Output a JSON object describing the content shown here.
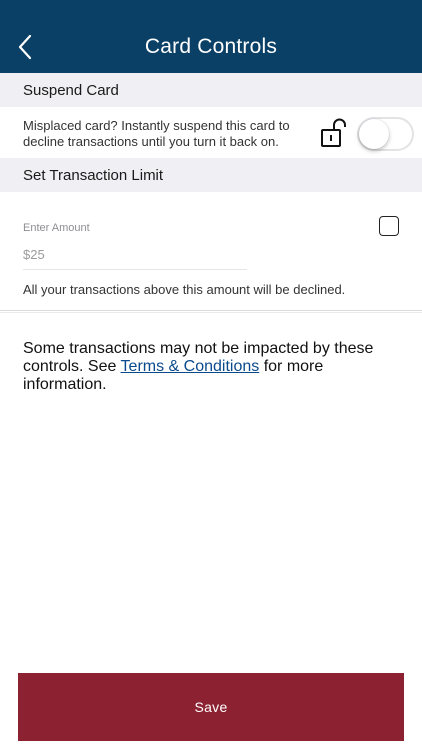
{
  "header": {
    "title": "Card Controls",
    "back_icon": "chevron-left-icon",
    "bg_color": "#0a4066"
  },
  "suspend": {
    "section_title": "Suspend Card",
    "description": "Misplaced card? Instantly suspend this card to decline transactions until you turn it back on.",
    "lock_icon": "unlocked-padlock-icon",
    "toggle_on": false
  },
  "limit": {
    "section_title": "Set Transaction Limit",
    "amount_label": "Enter Amount",
    "amount_placeholder": "$25",
    "checkbox_checked": false,
    "note": "All your transactions above this amount will be declined."
  },
  "disclaimer": {
    "before": "Some transactions may not be impacted by these controls. See ",
    "link_text": "Terms & Conditions",
    "after": " for more information."
  },
  "actions": {
    "save_label": "Save",
    "save_color": "#8b2131"
  }
}
